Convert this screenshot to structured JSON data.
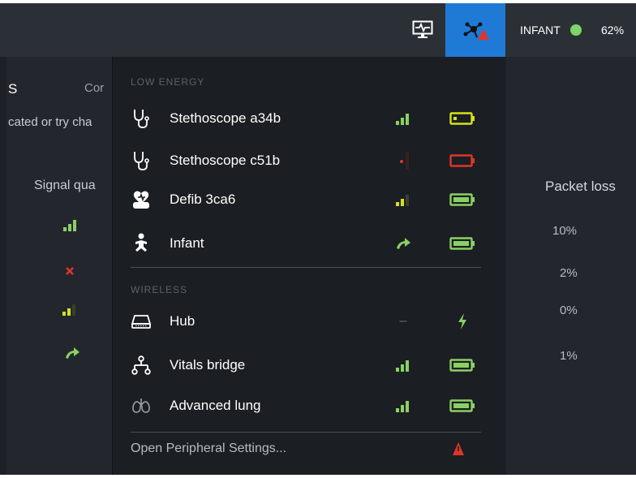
{
  "topbar": {
    "monitor_icon": "monitor-waveform-icon",
    "network_icon": "network-alert-icon",
    "patient_type": "INFANT",
    "status_color": "#7fd36b",
    "battery_percent": "62%",
    "accent": "#1f7ad6"
  },
  "background": {
    "title_fragment": "S",
    "col2_fragment": "Cor",
    "hint_fragment": "cated or try cha",
    "signal_quality_fragment": "Signal qua",
    "packet_loss_header": "Packet loss",
    "packet_loss_values": [
      "10%",
      "2%",
      "0%",
      "1%"
    ]
  },
  "dropdown": {
    "sections": [
      {
        "label": "LOW ENERGY",
        "devices": [
          {
            "name": "Stethoscope a34b",
            "icon": "stethoscope-icon",
            "signal": "good",
            "battery": "low"
          },
          {
            "name": "Stethoscope c51b",
            "icon": "stethoscope-icon",
            "signal": "none",
            "battery": "empty"
          },
          {
            "name": "Defib 3ca6",
            "icon": "defibrillator-icon",
            "signal": "fair",
            "battery": "full"
          },
          {
            "name": "Infant",
            "icon": "infant-icon",
            "signal": "wired",
            "battery": "full"
          }
        ]
      },
      {
        "label": "WIRELESS",
        "devices": [
          {
            "name": "Hub",
            "icon": "hub-icon",
            "signal": "–",
            "battery": "charging"
          },
          {
            "name": "Vitals bridge",
            "icon": "network-tree-icon",
            "signal": "good",
            "battery": "full"
          },
          {
            "name": "Advanced lung",
            "icon": "lungs-icon",
            "signal": "good",
            "battery": "full"
          }
        ]
      }
    ],
    "footer_link": "Open Peripheral Settings...",
    "colors": {
      "signal_good": "#8bd063",
      "signal_fair": "#d4e21d",
      "signal_bad": "#e0352b",
      "battery_ok": "#8bd063",
      "battery_low": "#d4e21d",
      "battery_empty": "#e0352b"
    }
  }
}
